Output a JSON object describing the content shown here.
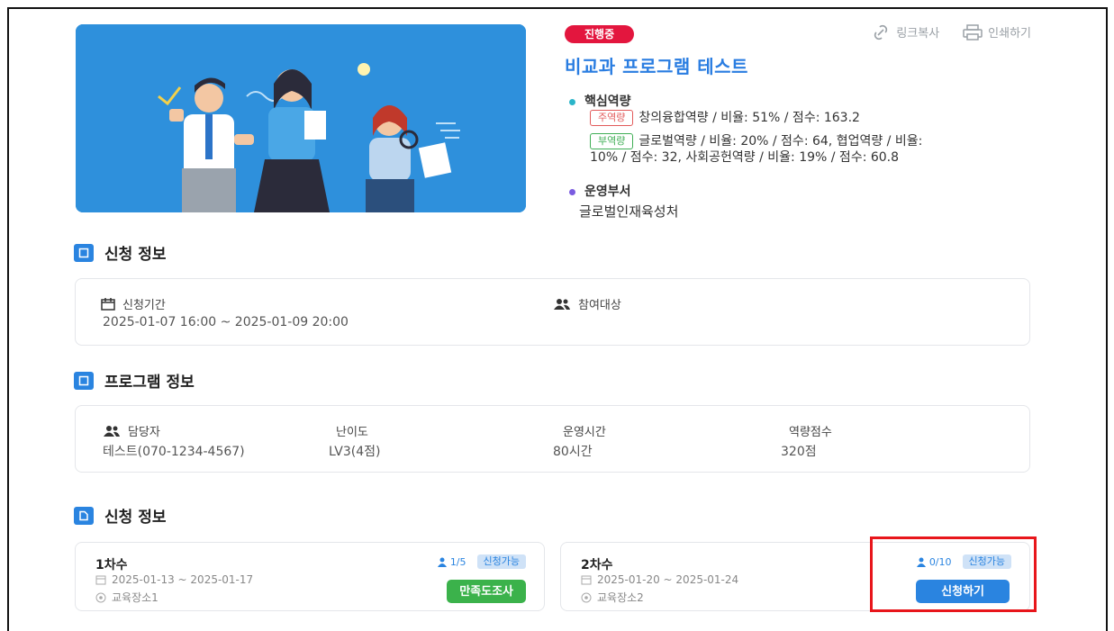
{
  "status_badge": "진행중",
  "actions": {
    "copy_link": "링크복사",
    "print": "인쇄하기"
  },
  "program_title": "비교과 프로그램 테스트",
  "competency": {
    "heading": "핵심역량",
    "main_tag": "주역량",
    "main_text": "창의융합역량 / 비율: 51% / 점수: 163.2",
    "sub_tag": "부역량",
    "sub_text_line1": "글로벌역량 / 비율: 20% / 점수: 64, 협업역량 / 비율:",
    "sub_text_line2": "10% / 점수: 32, 사회공헌역량 / 비율: 19% / 점수: 60.8"
  },
  "department": {
    "heading": "운영부서",
    "value": "글로벌인재육성처"
  },
  "apply_info": {
    "title": "신청 정보",
    "period_label": "신청기간",
    "period_value": "2025-01-07 16:00 ~ 2025-01-09 20:00",
    "target_label": "참여대상"
  },
  "program_info": {
    "title": "프로그램 정보",
    "manager_label": "담당자",
    "manager_value": "테스트(070-1234-4567)",
    "difficulty_label": "난이도",
    "difficulty_value": "LV3(4점)",
    "hours_label": "운영시간",
    "hours_value": "80시간",
    "score_label": "역량점수",
    "score_value": "320점"
  },
  "sessions_section": {
    "title": "신청 정보",
    "sessions": [
      {
        "name": "1차수",
        "dates": "2025-01-13 ~ 2025-01-17",
        "place": "교육장소1",
        "count": "1/5",
        "availability": "신청가능",
        "button": "만족도조사"
      },
      {
        "name": "2차수",
        "dates": "2025-01-20 ~ 2025-01-24",
        "place": "교육장소2",
        "count": "0/10",
        "availability": "신청가능",
        "button": "신청하기"
      }
    ]
  },
  "colors": {
    "brand_blue": "#2a84e0",
    "status_red": "#e3163e",
    "green": "#3bb24b",
    "highlight_red": "#e8161b"
  }
}
